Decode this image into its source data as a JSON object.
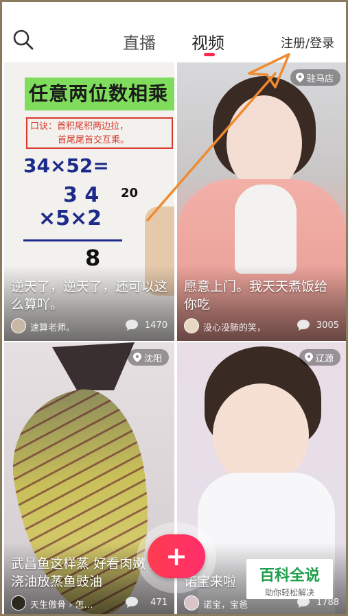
{
  "header": {
    "tabs": [
      {
        "label": "直播",
        "active": false
      },
      {
        "label": "视频",
        "active": true
      }
    ],
    "login_label": "注册/登录",
    "search_icon": "search-icon",
    "accent_color": "#ff2a52"
  },
  "feed": [
    {
      "caption": "逆天了，逆天了，还可以这么算吖。",
      "author": "速算老师。",
      "comments": "1470",
      "location": "",
      "illustration": {
        "title": "任意两位数相乘",
        "rule_line1": "口诀：首积尾积两边拉，",
        "rule_line2": "首尾尾首交互乘。",
        "eq": "34×52=",
        "num_top": "3 4",
        "num_bottom": "×5×2",
        "side": "20",
        "result": "8"
      }
    },
    {
      "caption": "愿意上门。我天天煮饭给你吃",
      "author": "没心没肺的笑，",
      "comments": "3005",
      "location": "驻马店"
    },
    {
      "caption": "武昌鱼这样蒸 好看肉嫩 好浇油放蒸鱼豉油",
      "author": "天生傲骨 › 怎…",
      "comments": "471",
      "location": "沈阳"
    },
    {
      "caption": "诺宝来啦",
      "author": "诺宝，宝爸",
      "comments": "1788",
      "location": "辽源"
    }
  ],
  "fab": {
    "label": "+"
  },
  "watermark": {
    "main": "百科全说",
    "sub": "助你轻松解决"
  },
  "annotation_color": "#f08a2e"
}
